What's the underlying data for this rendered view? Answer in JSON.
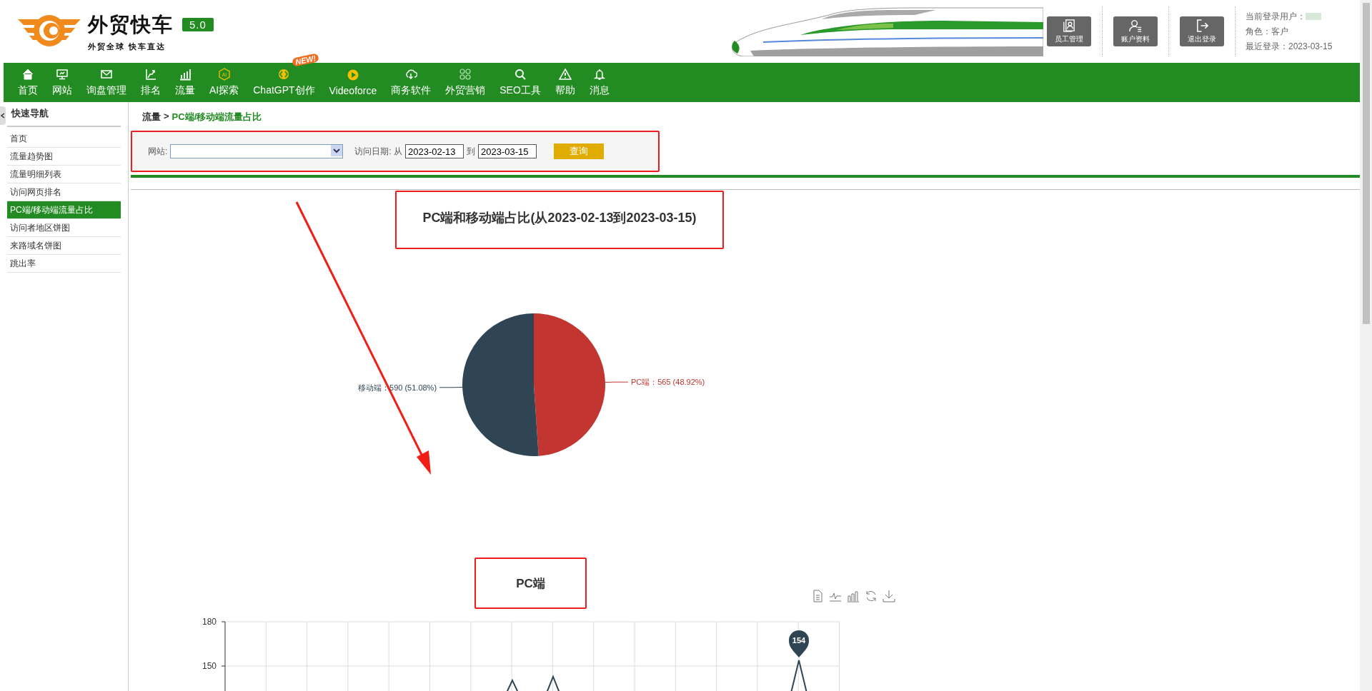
{
  "logo": {
    "name": "外贸快车",
    "version": "5.0",
    "slogan": "外贸全球 快车直达"
  },
  "header_buttons": [
    {
      "label": "员工管理"
    },
    {
      "label": "账户资料"
    },
    {
      "label": "退出登录"
    }
  ],
  "user_info": {
    "user_label": "当前登录用户：",
    "role": "角色：客户",
    "last_login": "最近登录：2023-03-15"
  },
  "nav": [
    {
      "label": "首页"
    },
    {
      "label": "网站"
    },
    {
      "label": "询盘管理"
    },
    {
      "label": "排名"
    },
    {
      "label": "流量"
    },
    {
      "label": "AI探索",
      "icon_text": "AI"
    },
    {
      "label": "ChatGPT创作",
      "badge": "NEW!"
    },
    {
      "label": "Videoforce"
    },
    {
      "label": "商务软件"
    },
    {
      "label": "外贸营销"
    },
    {
      "label": "SEO工具"
    },
    {
      "label": "帮助"
    },
    {
      "label": "消息"
    }
  ],
  "sidebar": {
    "title": "快速导航",
    "items": [
      {
        "label": "首页",
        "selected": false
      },
      {
        "label": "流量趋势图",
        "selected": false
      },
      {
        "label": "流量明细列表",
        "selected": false
      },
      {
        "label": "访问网页排名",
        "selected": false
      },
      {
        "label": "PC端/移动端流量占比",
        "selected": true
      },
      {
        "label": "访问者地区饼图",
        "selected": false
      },
      {
        "label": "来路域名饼图",
        "selected": false
      },
      {
        "label": "跳出率",
        "selected": false
      }
    ]
  },
  "breadcrumb": {
    "parent": "流量",
    "separator": ">",
    "current": "PC端/移动端流量占比"
  },
  "filter": {
    "site_label": "网站:",
    "date_label": "访问日期: 从",
    "start_date": "2023-02-13",
    "to_label": "到",
    "end_date": "2023-03-15",
    "query_button": "查询"
  },
  "pie_chart": {
    "title": "PC端和移动端占比(从2023-02-13到2023-03-15)",
    "slices": [
      {
        "label": "PC端：565 (48.92%)",
        "color": "#c23531"
      },
      {
        "label": "移动端：590 (51.08%)",
        "color": "#2f4554"
      }
    ],
    "chart_data": {
      "type": "pie",
      "values": [
        48.92,
        51.08
      ]
    }
  },
  "pc_chart": {
    "title": "PC端",
    "y_tick_labels": [
      "180",
      "150"
    ],
    "peak_label": "154"
  }
}
